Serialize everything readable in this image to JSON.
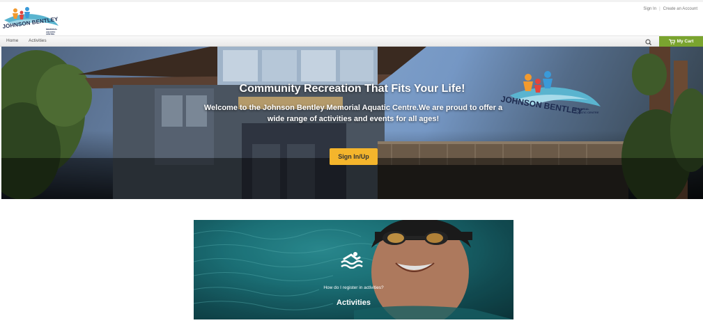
{
  "header": {
    "logo_text": "JOHNSON BENTLEY",
    "logo_subtext": "MEMORIAL AQUATIC CENTRE",
    "sign_in": "Sign In",
    "separator": "|",
    "create_account": "Create an Account"
  },
  "nav": {
    "items": [
      {
        "label": "Home"
      },
      {
        "label": "Activities"
      }
    ],
    "search_icon": "search-icon",
    "cart_label": "My Cart",
    "cart_icon": "cart-icon",
    "cart_color": "#7aa42f"
  },
  "hero": {
    "title": "Community Recreation That Fits Your Life!",
    "subtitle": "Welcome to the Johnson Bentley Memorial Aquatic Centre.We are proud to offer a wide range of activities and events for all ages!",
    "button_label": "Sign In/Up",
    "button_color": "#f4b52c",
    "sign_logo_text": "JOHNSON BENTLEY",
    "sign_logo_subtext": "MEMORIAL AQUATIC CENTRE"
  },
  "card": {
    "icon": "swimmer-icon",
    "question": "How do I register in activities?",
    "title": "Activities"
  }
}
